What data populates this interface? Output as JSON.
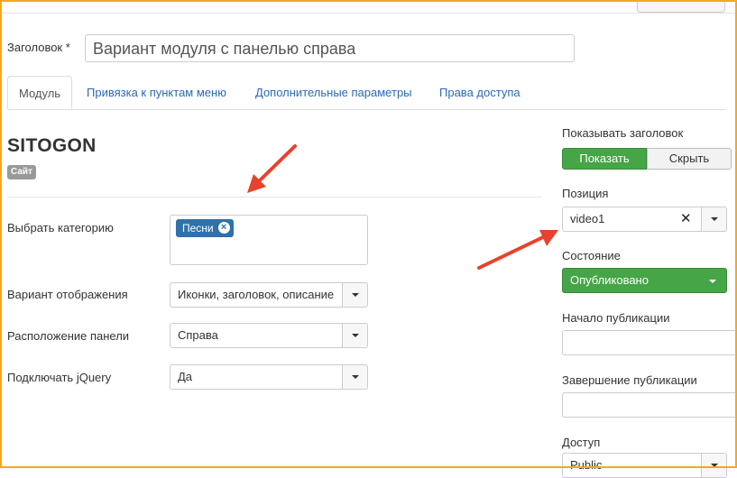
{
  "title_field": {
    "label": "Заголовок *",
    "value": "Вариант модуля с панелью справа"
  },
  "tabs": [
    {
      "label": "Модуль",
      "active": true
    },
    {
      "label": "Привязка к пунктам меню",
      "active": false
    },
    {
      "label": "Дополнительные параметры",
      "active": false
    },
    {
      "label": "Права доступа",
      "active": false
    }
  ],
  "module": {
    "name": "SITOGON",
    "badge": "Сайт"
  },
  "fields": {
    "category": {
      "label": "Выбрать категорию",
      "tags": [
        "Песни"
      ]
    },
    "display": {
      "label": "Вариант отображения",
      "value": "Иконки, заголовок, описание"
    },
    "panel_position": {
      "label": "Расположение панели",
      "value": "Справа"
    },
    "jquery": {
      "label": "Подключать jQuery",
      "value": "Да"
    }
  },
  "sidebar": {
    "show_title": {
      "label": "Показывать заголовок",
      "show": "Показать",
      "hide": "Скрыть"
    },
    "position": {
      "label": "Позиция",
      "value": "video1"
    },
    "state": {
      "label": "Состояние",
      "value": "Опубликовано"
    },
    "publish_up": {
      "label": "Начало публикации",
      "value": ""
    },
    "publish_down": {
      "label": "Завершение публикации",
      "value": ""
    },
    "access": {
      "label": "Доступ",
      "value": "Public"
    }
  },
  "colors": {
    "accent_blue": "#3071a9",
    "success_green": "#46a546",
    "annotation_red": "#e8412c",
    "frame_orange": "#f5a81e"
  },
  "icons": {
    "clear": "close-icon",
    "dropdown": "chevron-down-icon",
    "tag_remove": "remove-circle-icon"
  }
}
